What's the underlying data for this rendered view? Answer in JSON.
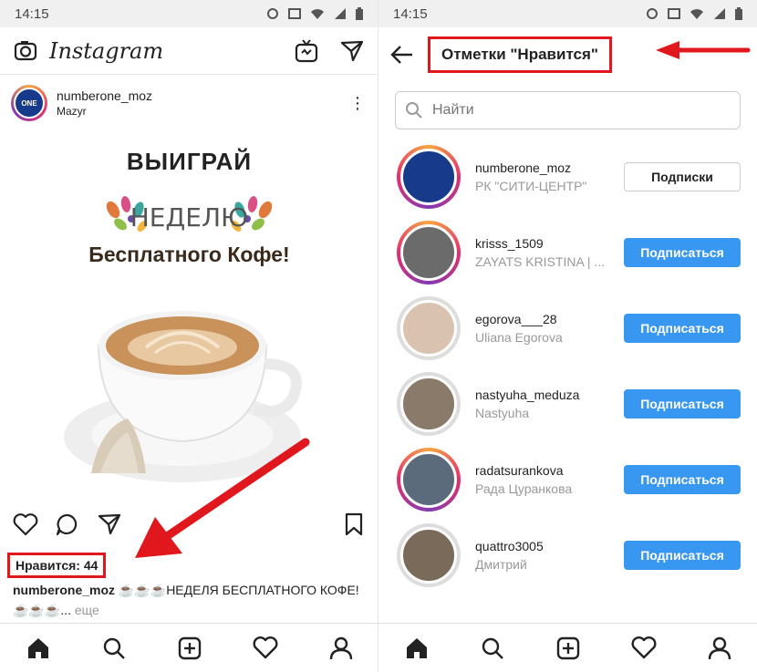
{
  "status": {
    "time": "14:15"
  },
  "left": {
    "app_title": "Instagram",
    "post": {
      "username": "numberone_moz",
      "location": "Mazyr",
      "avatar_text": "ONE",
      "promo_line1": "ВЫИГРАЙ",
      "promo_line2": "НЕДЕЛЮ",
      "promo_line3": "Бесплатного Кофе!",
      "likes": "Нравится: 44",
      "caption_user": "numberone_moz",
      "caption_text": " ☕☕☕НЕДЕЛЯ БЕСПЛАТНОГО КОФЕ!☕☕☕... ",
      "caption_more": "еще"
    }
  },
  "right": {
    "title": "Отметки \"Нравится\"",
    "search_placeholder": "Найти",
    "likers": [
      {
        "username": "numberone_moz",
        "fullname": "РК  \"СИТИ-ЦЕНТР\"",
        "button": "Подписки",
        "following": true,
        "story": true,
        "color": "#173a8a"
      },
      {
        "username": "krisss_1509",
        "fullname": "ZAYATS KRISTINA | ...",
        "button": "Подписаться",
        "following": false,
        "story": true,
        "color": "#6b6b6b"
      },
      {
        "username": "egorova___28",
        "fullname": "Uliana Egorova",
        "button": "Подписаться",
        "following": false,
        "story": false,
        "color": "#d9c3b0"
      },
      {
        "username": "nastyuha_meduza",
        "fullname": "Nastyuha",
        "button": "Подписаться",
        "following": false,
        "story": false,
        "color": "#8a7a6a"
      },
      {
        "username": "radatsurankova",
        "fullname": "Рада  Цуранкова",
        "button": "Подписаться",
        "following": false,
        "story": true,
        "color": "#5b6b7b"
      },
      {
        "username": "quattro3005",
        "fullname": "Дмитрий",
        "button": "Подписаться",
        "following": false,
        "story": false,
        "color": "#7a6a5a"
      }
    ]
  },
  "colors": {
    "accent_blue": "#3897f0",
    "highlight_red": "#e0171d"
  }
}
